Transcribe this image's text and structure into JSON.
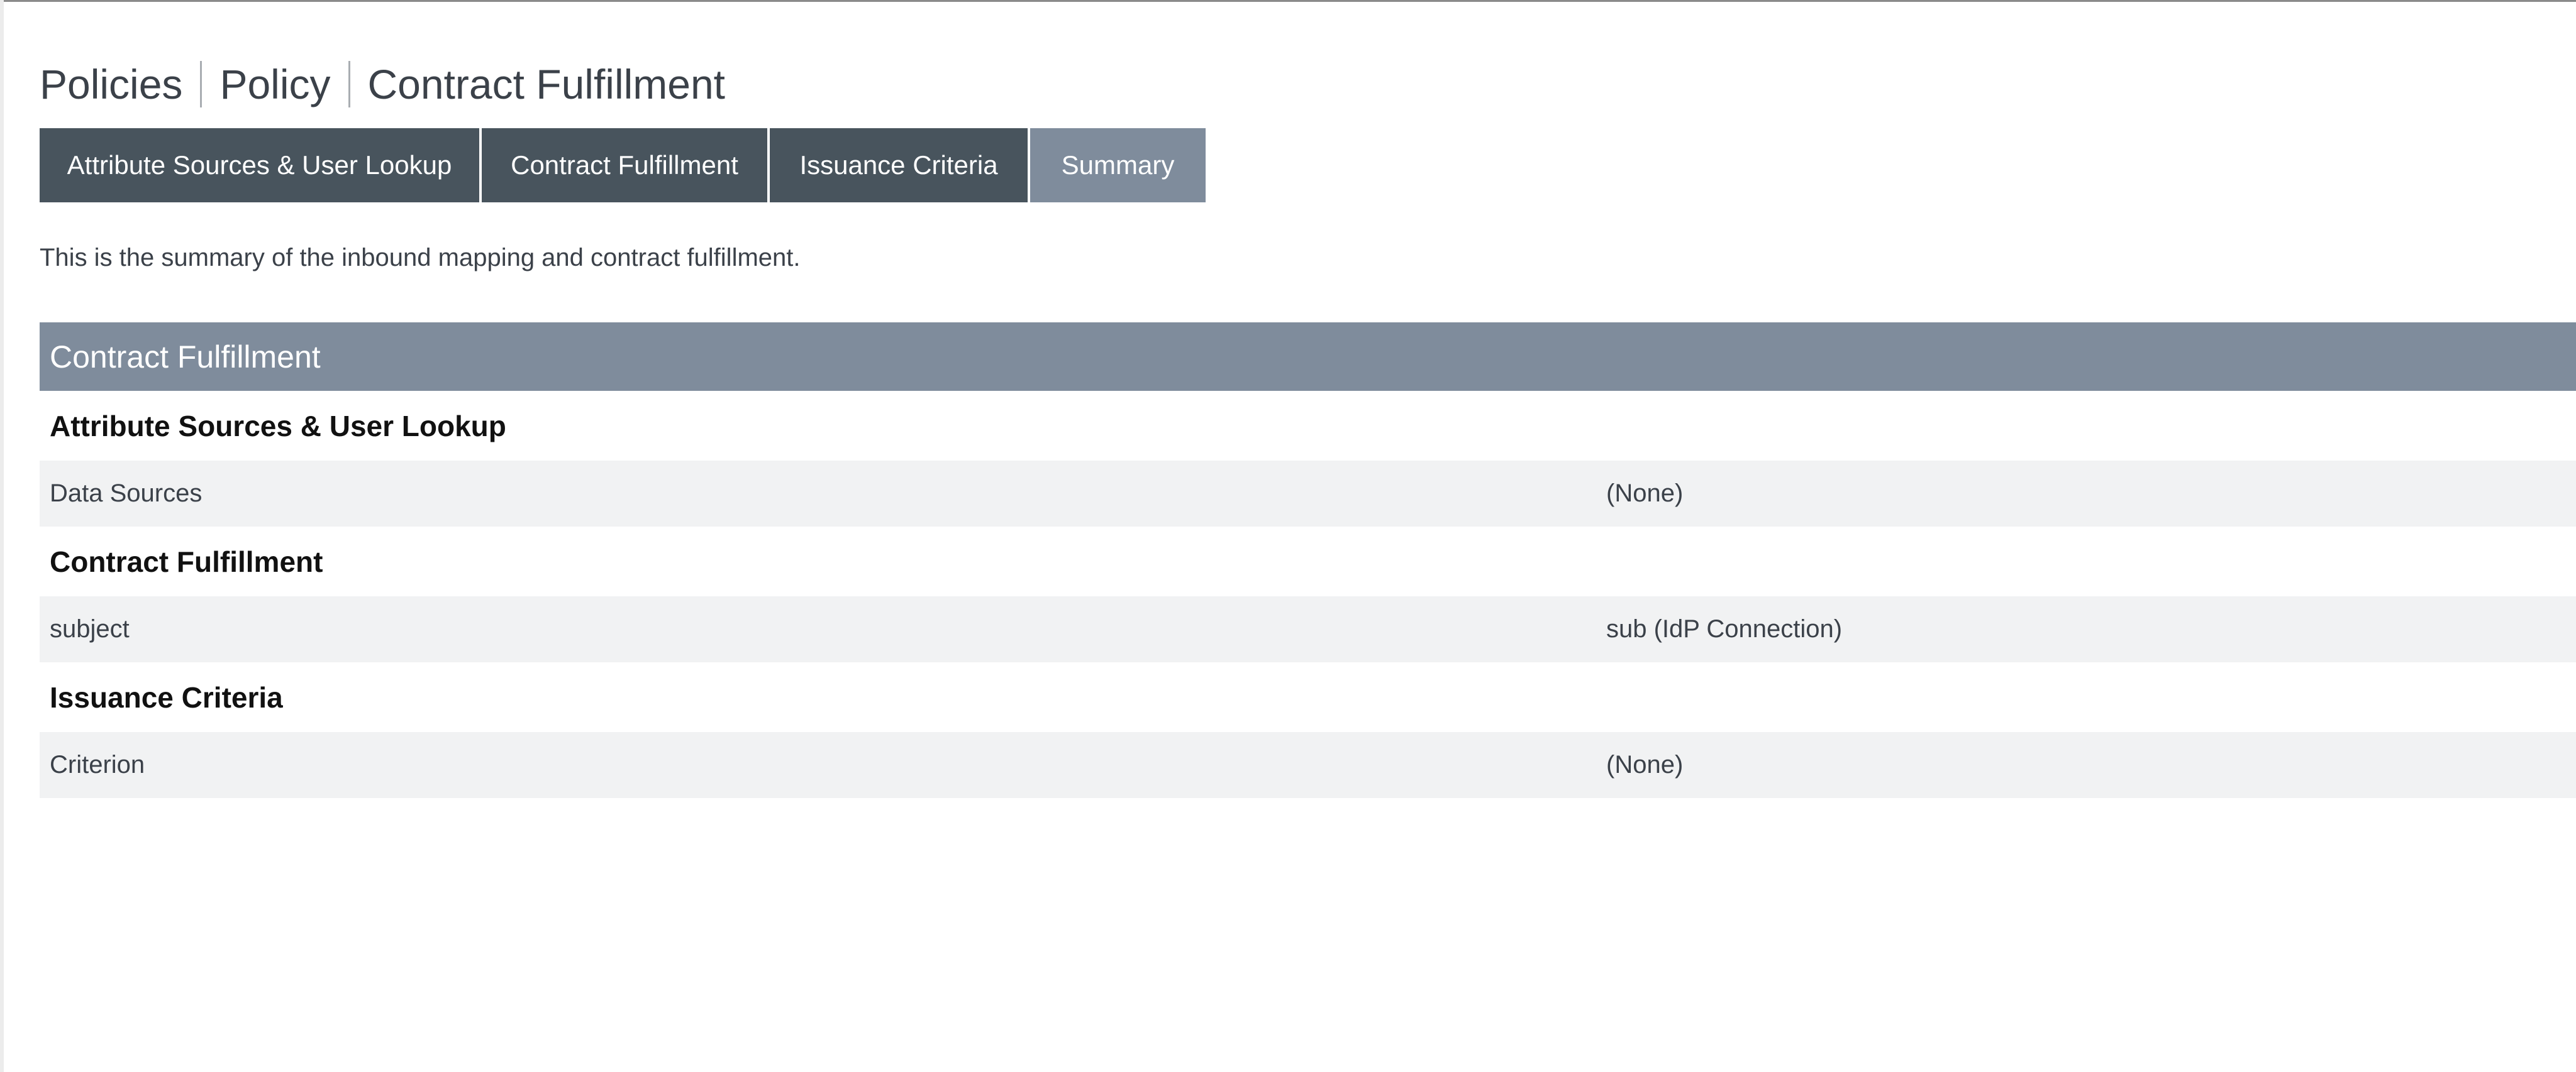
{
  "breadcrumb": [
    "Policies",
    "Policy",
    "Contract Fulfillment"
  ],
  "tabs": [
    {
      "label": "Attribute Sources & User Lookup",
      "active": false
    },
    {
      "label": "Contract Fulfillment",
      "active": false
    },
    {
      "label": "Issuance Criteria",
      "active": false
    },
    {
      "label": "Summary",
      "active": true
    }
  ],
  "intro_text": "This is the summary of the inbound mapping and contract fulfillment.",
  "summary": {
    "header": "Contract Fulfillment",
    "sections": [
      {
        "title": "Attribute Sources & User Lookup",
        "rows": [
          {
            "key": "Data Sources",
            "value": "(None)"
          }
        ]
      },
      {
        "title": "Contract Fulfillment",
        "rows": [
          {
            "key": "subject",
            "value": "sub (IdP Connection)"
          }
        ]
      },
      {
        "title": "Issuance Criteria",
        "rows": [
          {
            "key": "Criterion",
            "value": "(None)"
          }
        ]
      }
    ]
  },
  "colors": {
    "tab_bg": "#48545d",
    "tab_active_bg": "#7f8c9c",
    "header_bg": "#7f8c9c",
    "row_bg": "#f1f2f3",
    "text": "#3b4149"
  }
}
